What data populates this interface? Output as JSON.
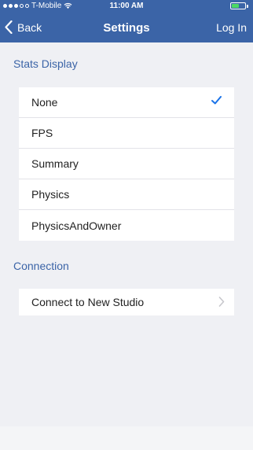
{
  "status_bar": {
    "carrier": "T-Mobile",
    "time": "11:00 AM"
  },
  "nav": {
    "back_label": "Back",
    "title": "Settings",
    "right_label": "Log In"
  },
  "stats_display": {
    "header": "Stats Display",
    "options": [
      "None",
      "FPS",
      "Summary",
      "Physics",
      "PhysicsAndOwner"
    ],
    "selected": "None"
  },
  "connection": {
    "header": "Connection",
    "items": [
      "Connect to New Studio"
    ]
  },
  "colors": {
    "nav_bar": "#3b64a7",
    "accent": "#1a73e8",
    "background": "#eff0f4"
  }
}
